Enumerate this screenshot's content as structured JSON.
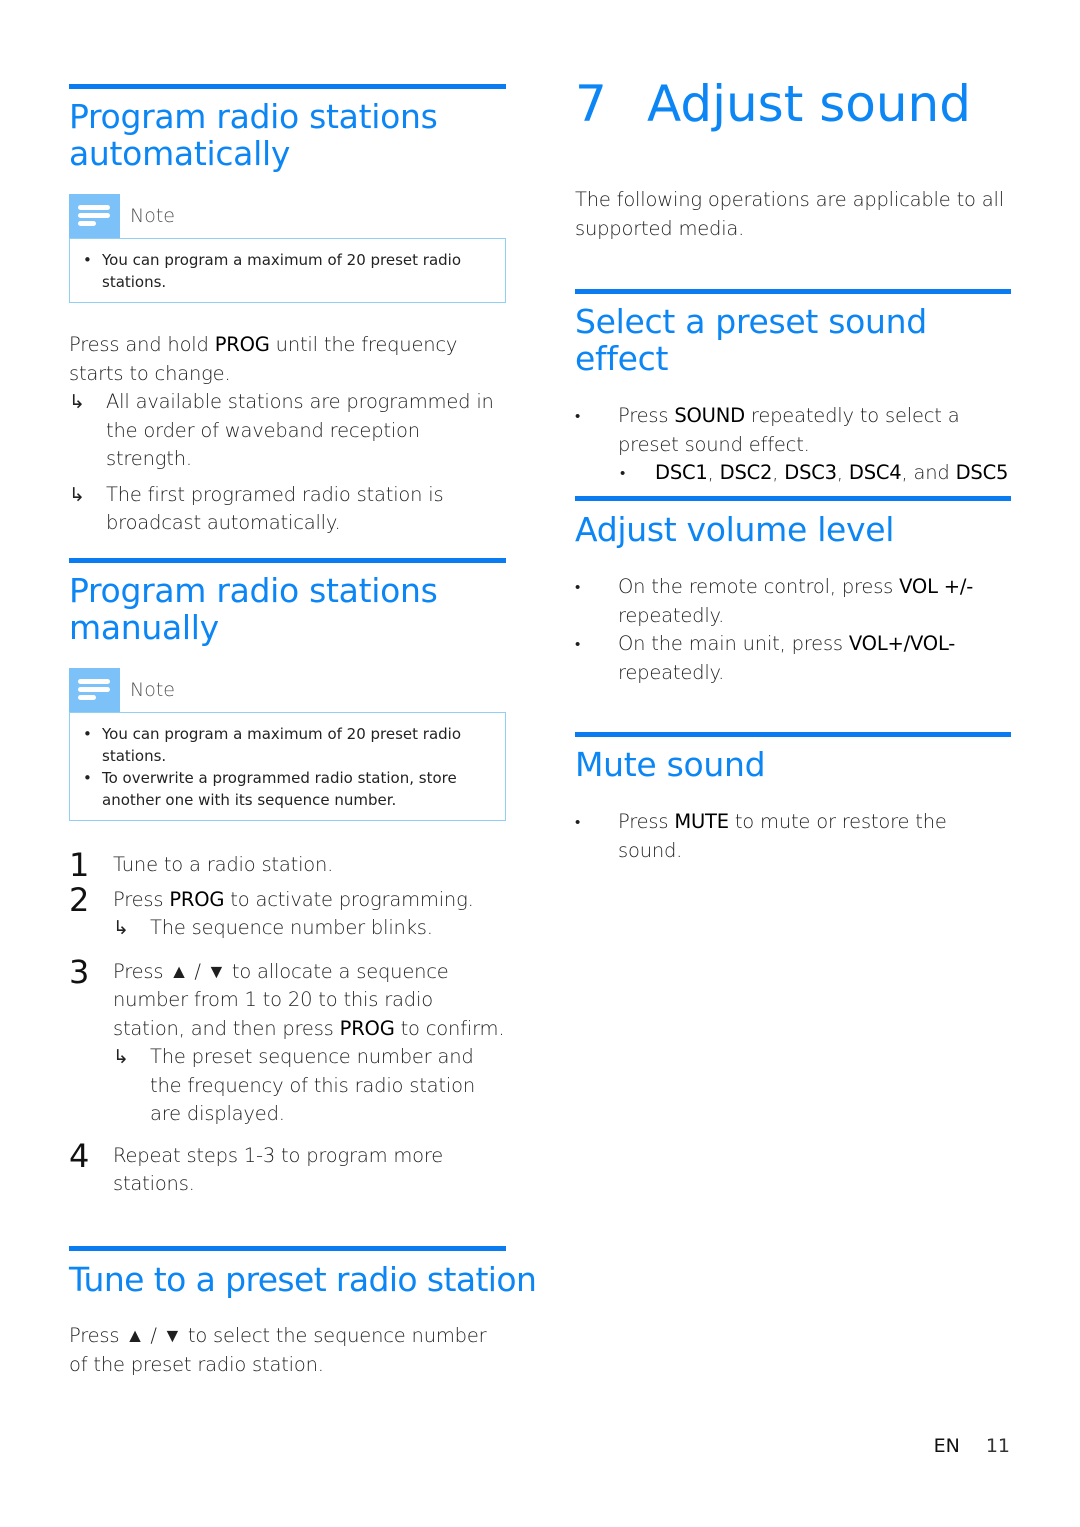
{
  "left": {
    "auto": {
      "title_line1": "Program radio stations",
      "title_line2": "automatically",
      "note_label": "Note",
      "note_items": [
        "You can program a maximum of 20 preset radio stations."
      ],
      "intro_pre": "Press and hold ",
      "intro_key": "PROG",
      "intro_post": " until the frequency starts to change.",
      "results": [
        "All available stations are programmed in the order of waveband reception strength.",
        "The first programed radio station is broadcast automatically."
      ]
    },
    "manual": {
      "title_line1": "Program radio stations",
      "title_line2": "manually",
      "note_label": "Note",
      "note_items": [
        "You can program a maximum of 20 preset radio stations.",
        "To overwrite a programmed radio station, store another one with its sequence number."
      ],
      "steps": [
        {
          "num": "1",
          "text": "Tune to a radio station."
        },
        {
          "num": "2",
          "pre": "Press ",
          "key": "PROG",
          "post": " to activate programming.",
          "result": "The sequence number blinks."
        },
        {
          "num": "3",
          "pre": "Press ▲ / ▼ to allocate a sequence number from 1 to 20 to this radio station, and then press ",
          "key": "PROG",
          "post": " to confirm.",
          "result": "The preset sequence number and the frequency of this radio station are displayed."
        },
        {
          "num": "4",
          "text": "Repeat steps 1-3 to program more stations."
        }
      ]
    },
    "tune": {
      "title": "Tune to a preset radio station",
      "text": "Press ▲ / ▼ to select the sequence number of the preset radio station."
    }
  },
  "right": {
    "chapter": {
      "num": "7",
      "title": "Adjust sound"
    },
    "intro": "The following operations are applicable to all supported media.",
    "preset": {
      "title": "Select a preset sound effect",
      "bullet_pre": "Press ",
      "bullet_key": "SOUND",
      "bullet_post": " repeatedly to select a preset sound effect.",
      "sub_keys": [
        "DSC1",
        "DSC2",
        "DSC3",
        "DSC4"
      ],
      "sub_and": "and",
      "sub_last": "DSC5"
    },
    "volume": {
      "title": "Adjust volume level",
      "items": [
        {
          "pre": "On the remote control, press ",
          "key": "VOL +/-",
          "post": " repeatedly."
        },
        {
          "pre": "On the main unit, press ",
          "key": "VOL+/VOL-",
          "post": " repeatedly."
        }
      ]
    },
    "mute": {
      "title": "Mute sound",
      "pre": "Press ",
      "key": "MUTE",
      "post": " to mute or restore the sound."
    }
  },
  "footer": {
    "lang": "EN",
    "page": "11"
  },
  "glyphs": {
    "arrow": "↳",
    "bullet": "•"
  },
  "colors": {
    "accent": "#0b86f4",
    "rule": "#0a7bf0",
    "note_icon": "#7cc1f7",
    "note_border": "#8fd0f4"
  }
}
